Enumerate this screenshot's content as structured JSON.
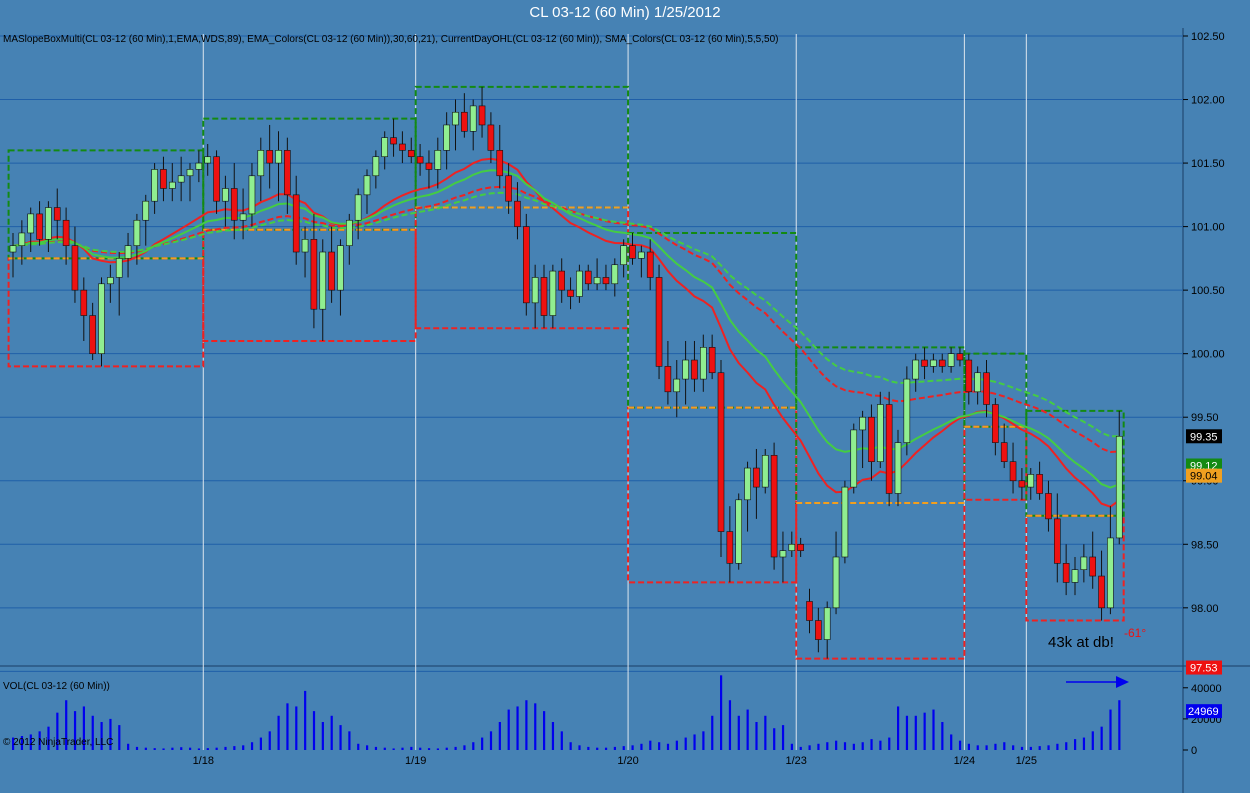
{
  "window": {
    "title": "CL 03-12 (60 Min)  1/25/2012",
    "indicators_label": "MASlopeBoxMulti(CL 03-12 (60 Min),1,EMA,WDS,89), EMA_Colors(CL 03-12 (60 Min)),30,60,21), CurrentDayOHL(CL 03-12 (60 Min)), SMA_Colors(CL 03-12 (60 Min),5,5,50)",
    "volume_label": "VOL(CL 03-12 (60 Min))",
    "copyright": "© 2012 NinjaTrader, LLC",
    "annotation": "43k at db!",
    "angle_label": "-61°"
  },
  "colors": {
    "background": "#4682b4",
    "up_candle": "#90ee90",
    "down_candle": "#ee1111",
    "wick": "#111111",
    "volume": "#0000ee",
    "grid": "#1f5fa8",
    "session_line": "#dde6ee",
    "ma_fast": "#ee2222",
    "ma_slow_green": "#44cc44",
    "box_green": "#138a13",
    "box_red": "#ee2222",
    "box_orange": "#f0a020"
  },
  "chart_data": {
    "type": "candlestick",
    "price_axis": {
      "ticks": [
        "102.50",
        "102.00",
        "101.50",
        "101.00",
        "100.50",
        "100.00",
        "99.50",
        "99.00",
        "98.50",
        "98.00"
      ],
      "range": [
        97.45,
        102.6
      ]
    },
    "volume_axis": {
      "ticks": [
        "40000",
        "20000",
        "0"
      ],
      "range": [
        0,
        45000
      ]
    },
    "date_labels": [
      "1/18",
      "1/19",
      "1/20",
      "1/23",
      "1/24",
      "1/25"
    ],
    "date_bar_index": [
      22,
      46,
      70,
      89,
      108,
      115
    ],
    "price_markers": [
      {
        "label": "99.35",
        "value": 99.35,
        "color": "#000000"
      },
      {
        "label": "99.12",
        "value": 99.12,
        "color": "#138a13"
      },
      {
        "label": "99.04",
        "value": 99.04,
        "color": "#f0a020"
      },
      {
        "label": "97.53",
        "value": 97.53,
        "color": "#ee1111"
      }
    ],
    "bars": [
      [
        100.8,
        100.95,
        100.6,
        100.85
      ],
      [
        100.85,
        101.05,
        100.7,
        100.95
      ],
      [
        100.95,
        101.15,
        100.8,
        101.1
      ],
      [
        101.1,
        101.2,
        100.85,
        100.9
      ],
      [
        100.9,
        101.2,
        100.8,
        101.15
      ],
      [
        101.15,
        101.3,
        100.9,
        101.05
      ],
      [
        101.05,
        101.15,
        100.7,
        100.85
      ],
      [
        100.85,
        101.0,
        100.4,
        100.5
      ],
      [
        100.5,
        100.6,
        100.1,
        100.3
      ],
      [
        100.3,
        100.4,
        99.95,
        100.0
      ],
      [
        100.0,
        100.6,
        99.9,
        100.55
      ],
      [
        100.55,
        100.7,
        100.4,
        100.6
      ],
      [
        100.6,
        100.8,
        100.3,
        100.75
      ],
      [
        100.75,
        100.95,
        100.6,
        100.85
      ],
      [
        100.85,
        101.1,
        100.7,
        101.05
      ],
      [
        101.05,
        101.25,
        100.85,
        101.2
      ],
      [
        101.2,
        101.5,
        101.1,
        101.45
      ],
      [
        101.45,
        101.55,
        101.2,
        101.3
      ],
      [
        101.3,
        101.5,
        101.2,
        101.35
      ],
      [
        101.35,
        101.55,
        101.2,
        101.4
      ],
      [
        101.4,
        101.5,
        101.2,
        101.45
      ],
      [
        101.45,
        101.6,
        101.35,
        101.5
      ],
      [
        101.5,
        101.65,
        101.4,
        101.55
      ],
      [
        101.55,
        101.6,
        101.1,
        101.2
      ],
      [
        101.2,
        101.4,
        101.0,
        101.3
      ],
      [
        101.3,
        101.5,
        100.9,
        101.05
      ],
      [
        101.05,
        101.3,
        100.9,
        101.1
      ],
      [
        101.1,
        101.5,
        101.0,
        101.4
      ],
      [
        101.4,
        101.7,
        101.2,
        101.6
      ],
      [
        101.6,
        101.8,
        101.3,
        101.5
      ],
      [
        101.5,
        101.75,
        101.2,
        101.6
      ],
      [
        101.6,
        101.7,
        101.1,
        101.25
      ],
      [
        101.25,
        101.4,
        100.7,
        100.8
      ],
      [
        100.8,
        101.0,
        100.6,
        100.9
      ],
      [
        100.9,
        101.1,
        100.2,
        100.35
      ],
      [
        100.35,
        100.9,
        100.1,
        100.8
      ],
      [
        100.8,
        101.0,
        100.4,
        100.5
      ],
      [
        100.5,
        100.9,
        100.3,
        100.85
      ],
      [
        100.85,
        101.1,
        100.7,
        101.05
      ],
      [
        101.05,
        101.3,
        100.9,
        101.25
      ],
      [
        101.25,
        101.45,
        101.1,
        101.4
      ],
      [
        101.4,
        101.6,
        101.3,
        101.55
      ],
      [
        101.55,
        101.75,
        101.45,
        101.7
      ],
      [
        101.7,
        101.85,
        101.55,
        101.65
      ],
      [
        101.65,
        101.75,
        101.5,
        101.6
      ],
      [
        101.6,
        101.7,
        101.5,
        101.55
      ],
      [
        101.55,
        101.65,
        101.4,
        101.5
      ],
      [
        101.5,
        101.6,
        101.3,
        101.45
      ],
      [
        101.45,
        101.7,
        101.3,
        101.6
      ],
      [
        101.6,
        101.9,
        101.45,
        101.8
      ],
      [
        101.8,
        102.0,
        101.6,
        101.9
      ],
      [
        101.9,
        102.05,
        101.7,
        101.75
      ],
      [
        101.75,
        102.0,
        101.6,
        101.95
      ],
      [
        101.95,
        102.1,
        101.7,
        101.8
      ],
      [
        101.8,
        101.9,
        101.5,
        101.6
      ],
      [
        101.6,
        101.8,
        101.3,
        101.4
      ],
      [
        101.4,
        101.5,
        101.1,
        101.2
      ],
      [
        101.2,
        101.35,
        100.9,
        101.0
      ],
      [
        101.0,
        101.1,
        100.3,
        100.4
      ],
      [
        100.4,
        100.7,
        100.2,
        100.6
      ],
      [
        100.6,
        100.7,
        100.2,
        100.3
      ],
      [
        100.3,
        100.7,
        100.2,
        100.65
      ],
      [
        100.65,
        100.75,
        100.4,
        100.5
      ],
      [
        100.5,
        100.6,
        100.35,
        100.45
      ],
      [
        100.45,
        100.7,
        100.4,
        100.65
      ],
      [
        100.65,
        100.7,
        100.5,
        100.55
      ],
      [
        100.55,
        100.75,
        100.5,
        100.6
      ],
      [
        100.6,
        100.7,
        100.5,
        100.55
      ],
      [
        100.55,
        100.75,
        100.45,
        100.7
      ],
      [
        100.7,
        100.9,
        100.6,
        100.85
      ],
      [
        100.85,
        100.95,
        100.7,
        100.75
      ],
      [
        100.75,
        100.85,
        100.6,
        100.8
      ],
      [
        100.8,
        100.9,
        100.5,
        100.6
      ],
      [
        100.6,
        100.7,
        99.8,
        99.9
      ],
      [
        99.9,
        100.1,
        99.6,
        99.7
      ],
      [
        99.7,
        99.95,
        99.5,
        99.8
      ],
      [
        99.8,
        100.1,
        99.6,
        99.95
      ],
      [
        99.95,
        100.1,
        99.7,
        99.8
      ],
      [
        99.8,
        100.15,
        99.7,
        100.05
      ],
      [
        100.05,
        100.15,
        99.8,
        99.85
      ],
      [
        99.85,
        99.95,
        98.4,
        98.6
      ],
      [
        98.6,
        98.8,
        98.2,
        98.35
      ],
      [
        98.35,
        98.9,
        98.3,
        98.85
      ],
      [
        98.85,
        99.15,
        98.6,
        99.1
      ],
      [
        99.1,
        99.25,
        98.7,
        98.95
      ],
      [
        98.95,
        99.25,
        98.9,
        99.2
      ],
      [
        99.2,
        99.3,
        98.3,
        98.4
      ],
      [
        98.4,
        98.6,
        98.2,
        98.45
      ],
      [
        98.45,
        98.6,
        98.4,
        98.5
      ],
      [
        98.5,
        98.55,
        98.4,
        98.45
      ],
      [
        98.05,
        98.15,
        97.8,
        97.9
      ],
      [
        97.9,
        98.0,
        97.65,
        97.75
      ],
      [
        97.75,
        98.05,
        97.6,
        98.0
      ],
      [
        98.0,
        98.6,
        97.95,
        98.4
      ],
      [
        98.4,
        99.0,
        98.35,
        98.95
      ],
      [
        98.95,
        99.45,
        98.9,
        99.4
      ],
      [
        99.4,
        99.55,
        99.1,
        99.5
      ],
      [
        99.5,
        99.6,
        99.0,
        99.15
      ],
      [
        99.15,
        99.7,
        99.1,
        99.6
      ],
      [
        99.6,
        99.7,
        98.8,
        98.9
      ],
      [
        98.9,
        99.4,
        98.8,
        99.3
      ],
      [
        99.3,
        99.9,
        99.2,
        99.8
      ],
      [
        99.8,
        100.0,
        99.7,
        99.95
      ],
      [
        99.95,
        100.05,
        99.8,
        99.9
      ],
      [
        99.9,
        100.0,
        99.85,
        99.95
      ],
      [
        99.95,
        100.0,
        99.85,
        99.9
      ],
      [
        99.9,
        100.05,
        99.85,
        100.0
      ],
      [
        100.0,
        100.05,
        99.9,
        99.95
      ],
      [
        99.95,
        100.0,
        99.6,
        99.7
      ],
      [
        99.7,
        99.9,
        99.6,
        99.85
      ],
      [
        99.85,
        99.95,
        99.5,
        99.6
      ],
      [
        99.6,
        99.65,
        99.2,
        99.3
      ],
      [
        99.3,
        99.45,
        99.1,
        99.15
      ],
      [
        99.15,
        99.3,
        98.9,
        99.0
      ],
      [
        99.0,
        99.1,
        98.85,
        98.95
      ],
      [
        98.95,
        99.1,
        98.85,
        99.05
      ],
      [
        99.05,
        99.15,
        98.85,
        98.9
      ],
      [
        98.9,
        99.0,
        98.6,
        98.7
      ],
      [
        98.7,
        98.9,
        98.2,
        98.35
      ],
      [
        98.35,
        98.5,
        98.1,
        98.2
      ],
      [
        98.2,
        98.4,
        98.1,
        98.3
      ],
      [
        98.3,
        98.5,
        98.2,
        98.4
      ],
      [
        98.4,
        98.6,
        98.15,
        98.25
      ],
      [
        98.25,
        98.45,
        97.9,
        98.0
      ],
      [
        98.0,
        98.8,
        97.95,
        98.55
      ],
      [
        98.55,
        99.55,
        98.5,
        99.35
      ]
    ],
    "volume": [
      8000,
      9000,
      10000,
      12000,
      15000,
      24000,
      32000,
      25000,
      28000,
      22000,
      18000,
      20000,
      16000,
      4000,
      2000,
      1500,
      1200,
      1000,
      1500,
      1800,
      1500,
      1000,
      1200,
      1500,
      2000,
      2500,
      3000,
      5000,
      8000,
      12000,
      22000,
      30000,
      28000,
      38000,
      25000,
      18000,
      22000,
      16000,
      12000,
      4000,
      3000,
      2000,
      1500,
      1000,
      1500,
      2000,
      1500,
      1200,
      1000,
      1500,
      2000,
      3000,
      5000,
      8000,
      12000,
      18000,
      26000,
      28000,
      32000,
      30000,
      25000,
      18000,
      12000,
      5000,
      3000,
      2000,
      1500,
      1500,
      2000,
      2500,
      3000,
      4000,
      6000,
      5000,
      4000,
      6000,
      8000,
      10000,
      12000,
      22000,
      48000,
      32000,
      22000,
      26000,
      18000,
      22000,
      14000,
      16000,
      4000,
      2000,
      3000,
      4000,
      5000,
      6000,
      5000,
      4000,
      5000,
      7000,
      6000,
      8000,
      28000,
      22000,
      22000,
      24000,
      26000,
      18000,
      10000,
      6000,
      4000,
      3000,
      3000,
      4000,
      5000,
      3000,
      2000,
      2000,
      2500,
      3000,
      4000,
      5000,
      7000,
      8000,
      12000,
      15000,
      26000,
      32000,
      25000
    ]
  }
}
